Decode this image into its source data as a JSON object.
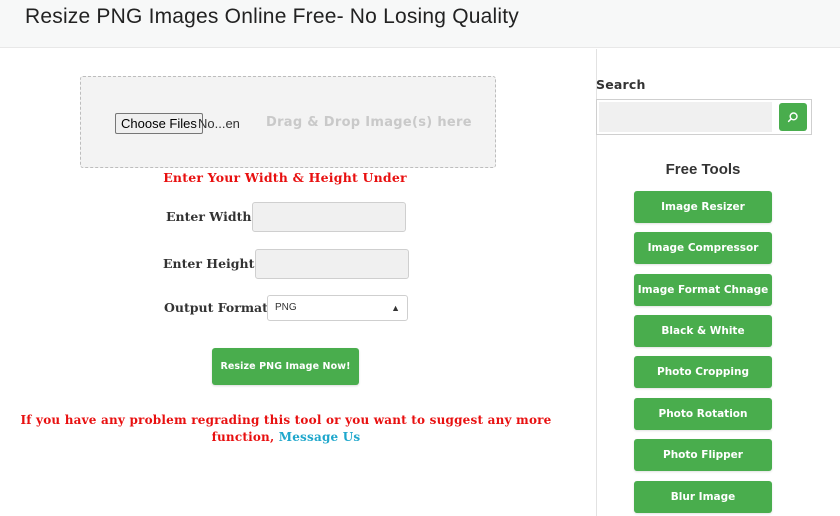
{
  "header": {
    "title": "Resize PNG Images Online Free- No Losing Quality"
  },
  "upload": {
    "choose_label": "Choose Files",
    "file_status": "No...en",
    "drop_hint": "Drag & Drop Image(s) here"
  },
  "form": {
    "instruction": "Enter Your Width & Height Under",
    "width_label": "Enter Width:",
    "width_value": "",
    "height_label": "Enter Height:",
    "height_value": "",
    "format_label": "Output Format:",
    "format_selected": "PNG",
    "submit_label": "Resize PNG Image Now!"
  },
  "note": {
    "text": "If you have any problem regrading this tool or you want to suggest any more function,",
    "link_label": "Message Us"
  },
  "sidebar": {
    "search_heading": "Search",
    "search_value": "",
    "tools_heading": "Free Tools",
    "tools": [
      {
        "label": "Image Resizer"
      },
      {
        "label": "Image Compressor"
      },
      {
        "label": "Image Format Chnage"
      },
      {
        "label": "Black & White"
      },
      {
        "label": "Photo Cropping"
      },
      {
        "label": "Photo Rotation"
      },
      {
        "label": "Photo Flipper"
      },
      {
        "label": "Blur Image"
      }
    ]
  },
  "icons": {
    "search_button": "search-icon",
    "select_arrows": "select-arrows-icon"
  },
  "colors": {
    "accent": "#49ad4d",
    "warning_text": "#e81010",
    "link": "#1ea7cc"
  }
}
